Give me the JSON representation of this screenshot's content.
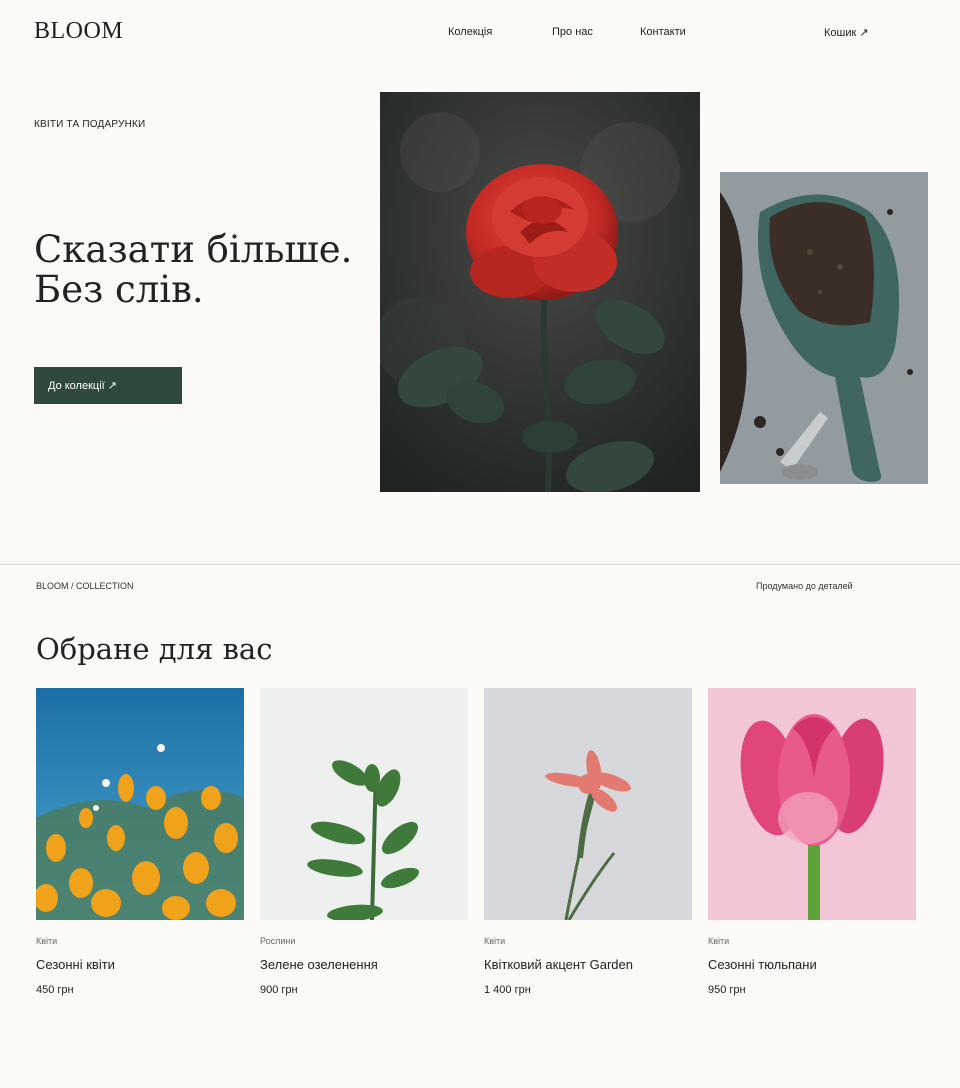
{
  "header": {
    "logo": "BLOOM",
    "nav": {
      "collection": "Колекція",
      "about": "Про нас",
      "contacts": "Контакти",
      "cart": "Кошик ↗"
    }
  },
  "hero": {
    "eyebrow": "КВІТИ ТА ПОДАРУНКИ",
    "title_line1": "Сказати більше.",
    "title_line2": "Без слів.",
    "cta_label": "До колекції ↗"
  },
  "section": {
    "breadcrumb": "BLOOM / COLLECTION",
    "tagline": "Продумано до деталей",
    "title": "Обране для вас"
  },
  "products": [
    {
      "category": "Квіти",
      "name": "Сезонні квіти",
      "price": "450 грн"
    },
    {
      "category": "Рослини",
      "name": "Зелене озеленення",
      "price": "900 грн"
    },
    {
      "category": "Квіти",
      "name": "Квітковий акцент Garden",
      "price": "1 400 грн"
    },
    {
      "category": "Квіти",
      "name": "Сезонні тюльпани",
      "price": "950 грн"
    }
  ],
  "colors": {
    "background": "#fbfaf7",
    "accent": "#2f4a3b",
    "text": "#1f1f1f"
  }
}
